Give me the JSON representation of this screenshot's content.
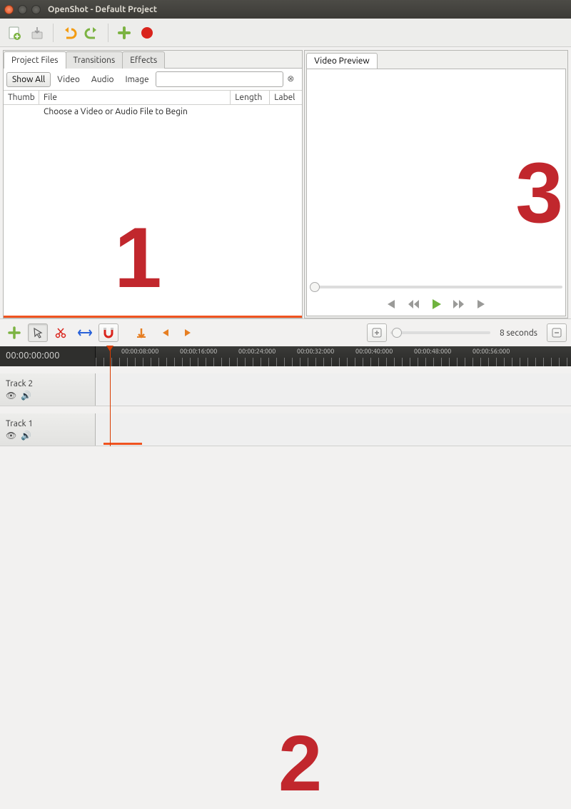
{
  "window": {
    "title": "OpenShot - Default Project"
  },
  "toolbar": {
    "icons": [
      "new-file-icon",
      "import-icon",
      "undo-icon",
      "redo-icon",
      "add-icon",
      "record-icon"
    ]
  },
  "left_panel": {
    "tabs": [
      {
        "label": "Project Files",
        "active": true
      },
      {
        "label": "Transitions",
        "active": false
      },
      {
        "label": "Effects",
        "active": false
      }
    ],
    "filters": {
      "show_all": "Show All",
      "video": "Video",
      "audio": "Audio",
      "image": "Image",
      "search_value": ""
    },
    "columns": {
      "thumb": "Thumb",
      "file": "File",
      "length": "Length",
      "label": "Label"
    },
    "placeholder": "Choose a Video or Audio File to Begin"
  },
  "preview": {
    "tab_label": "Video Preview",
    "controls": [
      "skip-start-icon",
      "rewind-icon",
      "play-icon",
      "forward-icon",
      "skip-end-icon"
    ]
  },
  "timeline_tools": {
    "icons": [
      "add-track-icon",
      "select-icon",
      "razor-icon",
      "resize-icon",
      "snap-icon",
      "marker-add-icon",
      "marker-prev-icon",
      "marker-next-icon"
    ],
    "zoom_label": "8 seconds"
  },
  "ruler": {
    "current_time": "00:00:00:000",
    "major_ticks": [
      "00:00:08:000",
      "00:00:16:000",
      "00:00:24:000",
      "00:00:32:000",
      "00:00:40:000",
      "00:00:48:000",
      "00:00:56:000"
    ]
  },
  "tracks": [
    {
      "name": "Track 2"
    },
    {
      "name": "Track 1"
    }
  ],
  "overlay": {
    "n1": "1",
    "n2": "2",
    "n3": "3"
  }
}
